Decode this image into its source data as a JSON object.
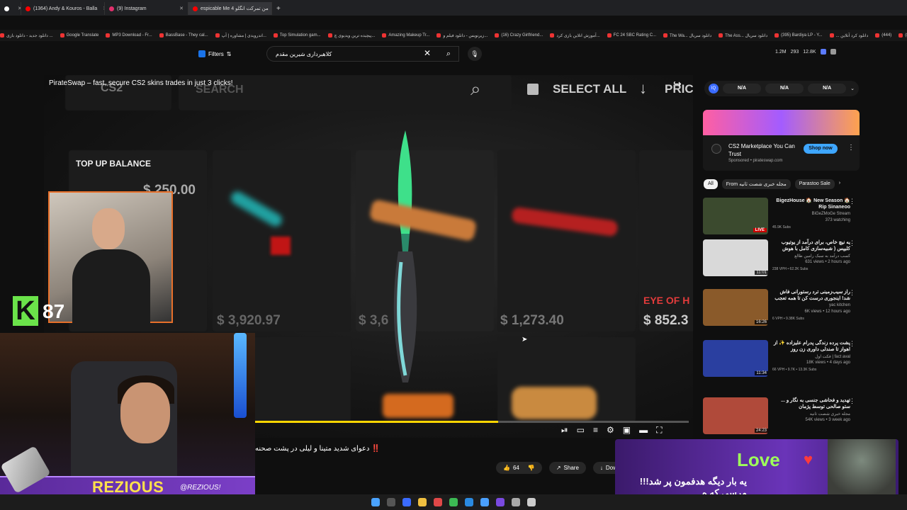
{
  "browser": {
    "tabs": [
      {
        "label": "",
        "color": "#ffffff",
        "active": false
      },
      {
        "label": "(1364) Andy & Kouros - Balla",
        "color": "#ff0000",
        "active": false
      },
      {
        "label": "(9) Instagram",
        "color": "#e1306c",
        "active": false
      },
      {
        "label": "espicable Me 4 من تمرکت انگلو",
        "color": "#ff0000",
        "active": true
      },
      {
        "label": "+",
        "color": "",
        "active": false
      }
    ],
    "bookmarks": [
      "دانلود جدید - دانلود بازی ...",
      "Google Translate",
      "MP3 Download - Fr...",
      "BassBase - They cal...",
      "اندرویدی | مشاوره | آپ...",
      "Top Simulation gam...",
      "پیچیده ترین ویدیوی چ...",
      "Amazing Makeup Tr...",
      "زیرنویس - دانلود فیلم و...",
      "(16) Crazy Girlfriend...",
      "آموزش انلاین بازی کرد...",
      "FC 24 SBC Rating C...",
      "The Wa... دانلود سریال",
      "The Ass... دانلود سریال",
      "(395) Bardiya LP - Y...",
      "... دانلود کرد آنلاین",
      "(444)",
      "(887) Men Rank Th"
    ]
  },
  "header": {
    "filters_label": "Filters",
    "search_value": "کلاهبرداری شیرین مقدم",
    "stats": [
      "1.2M",
      "293",
      "12.8K"
    ]
  },
  "player": {
    "title": "PirateSwap – fast, secure CS2 skins trades in just 3 clicks!",
    "blurred_labels": {
      "cs2": "CS2",
      "search": "SEARCH",
      "select_all": "SELECT ALL",
      "price": "PRIC",
      "top_up": "TOP UP BALANCE",
      "price1": "$ 250.00",
      "price2": "$ 3,920.97",
      "price3": "$ 3,6",
      "price4": "$ 1,273.40",
      "price5": "$ 852.3",
      "eye": "EYE OF H"
    },
    "progress": 0.56
  },
  "overlay": {
    "k_count": "87",
    "streamer_name": "REZIOUS",
    "handle": "@REZIOUS!",
    "love_word": "Love",
    "love_message": "یه بار دیگه هدفمون پر شد!!! مرسی که ه"
  },
  "below_player": {
    "heading": "دعوای شدید متینا و لیلی در پشت صحنه ‼️",
    "likes": "64",
    "share_label": "Share",
    "download_label": "Down"
  },
  "sidebar": {
    "na_chips": [
      "N/A",
      "N/A",
      "N/A"
    ],
    "ad": {
      "title": "CS2 Marketplace You Can Trust",
      "sponsored": "Sponsored • pirateswap.com",
      "cta": "Shop now"
    },
    "filter_chips": [
      "All",
      "From مجله خبری شصت ثانیه",
      "Parastoo Sale"
    ],
    "recommendations": [
      {
        "title": "BigezHouse 🏠 New Season 🏠 Rip Sinaneoo",
        "channel": "BiGeZMoGe Stream",
        "meta": "373 watching",
        "tag": "45.9K Subs",
        "badge": "LIVE",
        "thumb": "#3b4a2e"
      },
      {
        "title": "یه نیچ خاص، برای درآمد از یوتیوب کلیپس ( شبیه‌سازی کامل با هوش",
        "channel": "کسب درآمد به سبک رامین طالع",
        "meta": "631 views • 2 hours ago",
        "tag": "238 VPH • 62.2K Subs",
        "badge": "11:01",
        "thumb": "#d9d9d9"
      },
      {
        "title": "راز سیب‌زمینی ترد رستورانی فاش شد! اینجوری درست کن تا همه تعجب",
        "channel": "yac kitchen",
        "meta": "6K views • 12 hours ago",
        "tag": "6 VPH • 9.38K Subs",
        "badge": "16:26",
        "thumb": "#8a5a2a"
      },
      {
        "title": "پشت پرده زندگی پدرام علیزاده ✨ از اهواز تا صندلی داوری زن روز",
        "channel": "فکت اول | fact aval",
        "meta": "18K views • 4 days ago",
        "tag": "66 VPH • 9.7K • 13.3K Subs",
        "badge": "11:34",
        "thumb": "#2a3fa0"
      },
      {
        "title": "تهدید و فحاشی جنسی به نگار و ... ستو صالحی توسط پژمان",
        "channel": "مجله خبری شصت ثانیه",
        "meta": "54K views • 3 week ago",
        "tag": "",
        "badge": "24:23",
        "thumb": "#b04a3a"
      }
    ]
  }
}
